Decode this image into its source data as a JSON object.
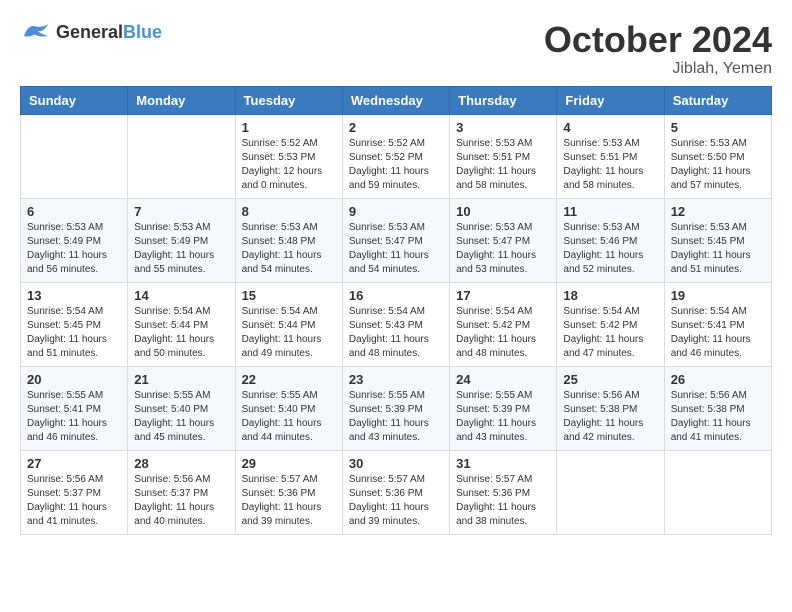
{
  "logo": {
    "general": "General",
    "blue": "Blue"
  },
  "title": "October 2024",
  "location": "Jiblah, Yemen",
  "days_of_week": [
    "Sunday",
    "Monday",
    "Tuesday",
    "Wednesday",
    "Thursday",
    "Friday",
    "Saturday"
  ],
  "weeks": [
    [
      {
        "day": "",
        "info": ""
      },
      {
        "day": "",
        "info": ""
      },
      {
        "day": "1",
        "info": "Sunrise: 5:52 AM\nSunset: 5:53 PM\nDaylight: 12 hours and 0 minutes."
      },
      {
        "day": "2",
        "info": "Sunrise: 5:52 AM\nSunset: 5:52 PM\nDaylight: 11 hours and 59 minutes."
      },
      {
        "day": "3",
        "info": "Sunrise: 5:53 AM\nSunset: 5:51 PM\nDaylight: 11 hours and 58 minutes."
      },
      {
        "day": "4",
        "info": "Sunrise: 5:53 AM\nSunset: 5:51 PM\nDaylight: 11 hours and 58 minutes."
      },
      {
        "day": "5",
        "info": "Sunrise: 5:53 AM\nSunset: 5:50 PM\nDaylight: 11 hours and 57 minutes."
      }
    ],
    [
      {
        "day": "6",
        "info": "Sunrise: 5:53 AM\nSunset: 5:49 PM\nDaylight: 11 hours and 56 minutes."
      },
      {
        "day": "7",
        "info": "Sunrise: 5:53 AM\nSunset: 5:49 PM\nDaylight: 11 hours and 55 minutes."
      },
      {
        "day": "8",
        "info": "Sunrise: 5:53 AM\nSunset: 5:48 PM\nDaylight: 11 hours and 54 minutes."
      },
      {
        "day": "9",
        "info": "Sunrise: 5:53 AM\nSunset: 5:47 PM\nDaylight: 11 hours and 54 minutes."
      },
      {
        "day": "10",
        "info": "Sunrise: 5:53 AM\nSunset: 5:47 PM\nDaylight: 11 hours and 53 minutes."
      },
      {
        "day": "11",
        "info": "Sunrise: 5:53 AM\nSunset: 5:46 PM\nDaylight: 11 hours and 52 minutes."
      },
      {
        "day": "12",
        "info": "Sunrise: 5:53 AM\nSunset: 5:45 PM\nDaylight: 11 hours and 51 minutes."
      }
    ],
    [
      {
        "day": "13",
        "info": "Sunrise: 5:54 AM\nSunset: 5:45 PM\nDaylight: 11 hours and 51 minutes."
      },
      {
        "day": "14",
        "info": "Sunrise: 5:54 AM\nSunset: 5:44 PM\nDaylight: 11 hours and 50 minutes."
      },
      {
        "day": "15",
        "info": "Sunrise: 5:54 AM\nSunset: 5:44 PM\nDaylight: 11 hours and 49 minutes."
      },
      {
        "day": "16",
        "info": "Sunrise: 5:54 AM\nSunset: 5:43 PM\nDaylight: 11 hours and 48 minutes."
      },
      {
        "day": "17",
        "info": "Sunrise: 5:54 AM\nSunset: 5:42 PM\nDaylight: 11 hours and 48 minutes."
      },
      {
        "day": "18",
        "info": "Sunrise: 5:54 AM\nSunset: 5:42 PM\nDaylight: 11 hours and 47 minutes."
      },
      {
        "day": "19",
        "info": "Sunrise: 5:54 AM\nSunset: 5:41 PM\nDaylight: 11 hours and 46 minutes."
      }
    ],
    [
      {
        "day": "20",
        "info": "Sunrise: 5:55 AM\nSunset: 5:41 PM\nDaylight: 11 hours and 46 minutes."
      },
      {
        "day": "21",
        "info": "Sunrise: 5:55 AM\nSunset: 5:40 PM\nDaylight: 11 hours and 45 minutes."
      },
      {
        "day": "22",
        "info": "Sunrise: 5:55 AM\nSunset: 5:40 PM\nDaylight: 11 hours and 44 minutes."
      },
      {
        "day": "23",
        "info": "Sunrise: 5:55 AM\nSunset: 5:39 PM\nDaylight: 11 hours and 43 minutes."
      },
      {
        "day": "24",
        "info": "Sunrise: 5:55 AM\nSunset: 5:39 PM\nDaylight: 11 hours and 43 minutes."
      },
      {
        "day": "25",
        "info": "Sunrise: 5:56 AM\nSunset: 5:38 PM\nDaylight: 11 hours and 42 minutes."
      },
      {
        "day": "26",
        "info": "Sunrise: 5:56 AM\nSunset: 5:38 PM\nDaylight: 11 hours and 41 minutes."
      }
    ],
    [
      {
        "day": "27",
        "info": "Sunrise: 5:56 AM\nSunset: 5:37 PM\nDaylight: 11 hours and 41 minutes."
      },
      {
        "day": "28",
        "info": "Sunrise: 5:56 AM\nSunset: 5:37 PM\nDaylight: 11 hours and 40 minutes."
      },
      {
        "day": "29",
        "info": "Sunrise: 5:57 AM\nSunset: 5:36 PM\nDaylight: 11 hours and 39 minutes."
      },
      {
        "day": "30",
        "info": "Sunrise: 5:57 AM\nSunset: 5:36 PM\nDaylight: 11 hours and 39 minutes."
      },
      {
        "day": "31",
        "info": "Sunrise: 5:57 AM\nSunset: 5:36 PM\nDaylight: 11 hours and 38 minutes."
      },
      {
        "day": "",
        "info": ""
      },
      {
        "day": "",
        "info": ""
      }
    ]
  ]
}
